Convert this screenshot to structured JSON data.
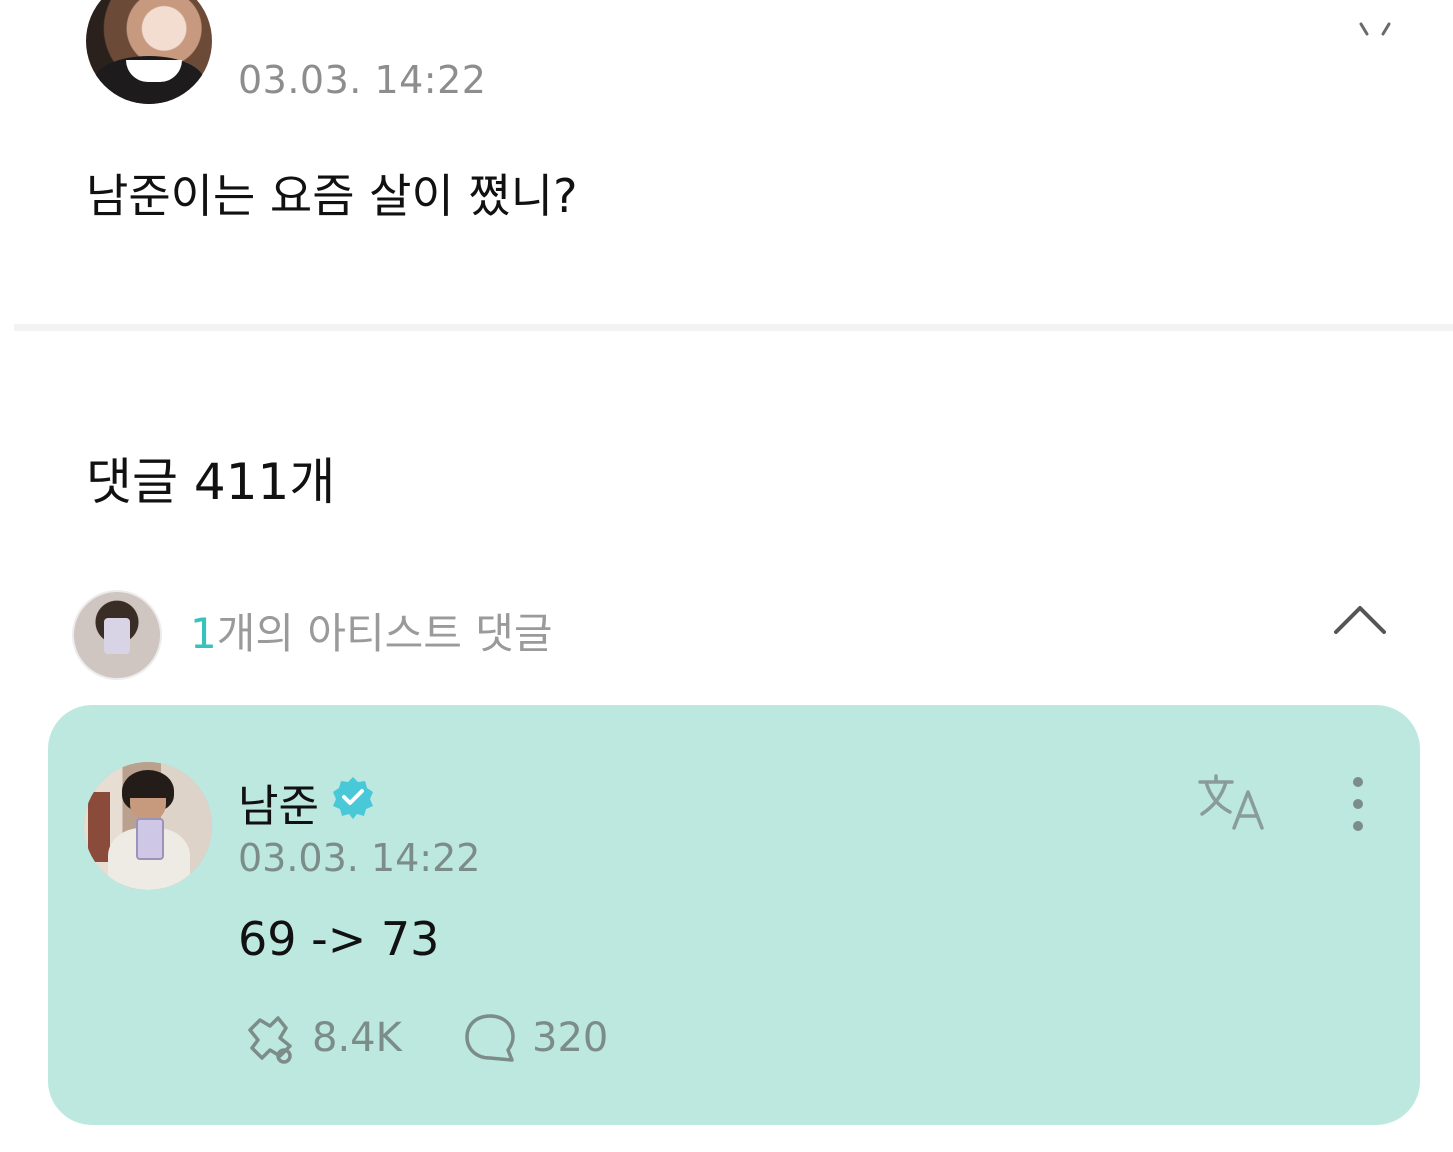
{
  "post": {
    "time": "03.03. 14:22",
    "text": "남준이는 요즘 살이 쪘니?"
  },
  "comments": {
    "count_label": "댓글 411개"
  },
  "artist_bar": {
    "count": "1",
    "label": "개의 아티스트 댓글"
  },
  "artist_comment": {
    "name": "남준",
    "time": "03.03. 14:22",
    "text": "69 -> 73",
    "likes": "8.4K",
    "replies": "320"
  },
  "colors": {
    "card_background": "#bde8e0",
    "accent": "#38c2bd",
    "muted_text": "#8d8d8d"
  },
  "icons": [
    "verified-badge-icon",
    "translate-icon",
    "more-vertical-icon",
    "cheer-like-icon",
    "comment-bubble-icon",
    "chevron-up-icon"
  ]
}
